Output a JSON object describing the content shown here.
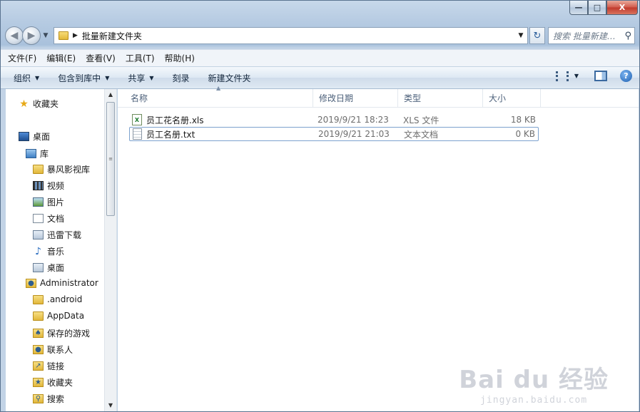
{
  "window": {
    "caption": {
      "minimize": "—",
      "maximize": "□",
      "close": "X"
    }
  },
  "address": {
    "path": "批量新建文件夹",
    "search_placeholder": "搜索 批量新建…"
  },
  "menubar": {
    "items": [
      "文件(F)",
      "编辑(E)",
      "查看(V)",
      "工具(T)",
      "帮助(H)"
    ]
  },
  "toolbar": {
    "organize": "组织",
    "include_in_library": "包含到库中",
    "share": "共享",
    "burn": "刻录",
    "new_folder": "新建文件夹"
  },
  "navpane": {
    "items": [
      {
        "label": "收藏夹",
        "icon": "star-icon"
      },
      {
        "label": "桌面",
        "icon": "desktop-icon"
      },
      {
        "label": "库",
        "icon": "library-icon"
      },
      {
        "label": "暴风影视库",
        "icon": "folder-icon"
      },
      {
        "label": "视频",
        "icon": "video-icon"
      },
      {
        "label": "图片",
        "icon": "picture-icon"
      },
      {
        "label": "文档",
        "icon": "document-icon"
      },
      {
        "label": "迅雷下载",
        "icon": "download-icon"
      },
      {
        "label": "音乐",
        "icon": "music-icon"
      },
      {
        "label": "桌面",
        "icon": "desktop-library-icon"
      },
      {
        "label": "Administrator",
        "icon": "user-folder-icon"
      },
      {
        "label": ".android",
        "icon": "folder-icon"
      },
      {
        "label": "AppData",
        "icon": "folder-icon"
      },
      {
        "label": "保存的游戏",
        "icon": "saved-games-icon"
      },
      {
        "label": "联系人",
        "icon": "contacts-icon"
      },
      {
        "label": "链接",
        "icon": "links-icon"
      },
      {
        "label": "收藏夹",
        "icon": "favorites-folder-icon"
      },
      {
        "label": "搜索",
        "icon": "searches-icon"
      }
    ]
  },
  "columns": {
    "name": "名称",
    "date": "修改日期",
    "type": "类型",
    "size": "大小"
  },
  "files": [
    {
      "name": "员工花名册.xls",
      "date": "2019/9/21 18:23",
      "type": "XLS 文件",
      "size": "18 KB",
      "icon": "xls-file-icon"
    },
    {
      "name": "员工名册.txt",
      "date": "2019/9/21 21:03",
      "type": "文本文档",
      "size": "0 KB",
      "icon": "txt-file-icon"
    }
  ],
  "watermark": {
    "logo": "Bai du 经验",
    "url": "jingyan.baidu.com"
  }
}
